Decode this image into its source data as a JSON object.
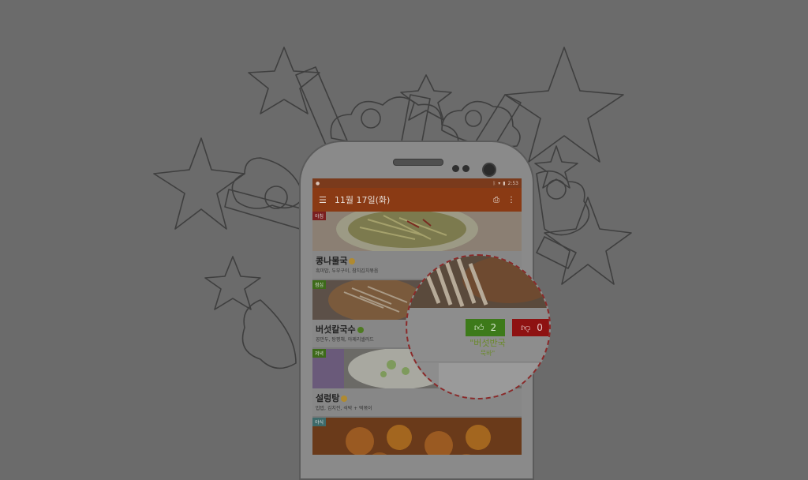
{
  "colors": {
    "backdrop": "#6b6b6b",
    "appbar": "#8a3a14",
    "like": "#3d7a1a",
    "dislike": "#8e1212",
    "menu_highlight": "#6a8a2a"
  },
  "statusbar": {
    "time": "2:53",
    "icons": [
      "bluetooth-icon",
      "wifi-icon",
      "signal-icon",
      "battery-icon"
    ]
  },
  "appbar": {
    "menu_icon": "hamburger-icon",
    "title": "11월 17일(화)",
    "actions": [
      "print-icon",
      "more-vert-icon"
    ]
  },
  "meals": [
    {
      "tag": "아침",
      "name": "콩나물국",
      "badge_color": "#c9a23a",
      "sides": "흑미밥, 두부구이, 참치김치볶음"
    },
    {
      "tag": "점심",
      "name": "버섯칼국수",
      "badge_color": "#5a8a2a",
      "sides": "꽁만두, 탕평채, 아제리샐러드"
    },
    {
      "tag": "저녁",
      "name": "설렁탕",
      "badge_color": "#c9a23a",
      "sides": "밥밥, 김치전, 석박 + 떡볶이"
    },
    {
      "tag": "야식",
      "name": "",
      "badge_color": "#8a8a8a",
      "sides": ""
    }
  ],
  "zoom": {
    "like_count": "2",
    "dislike_count": "0",
    "menu_line1": "\"버섯반국",
    "menu_line2": "묵바\"",
    "like_icon": "thumbs-up-icon",
    "dislike_icon": "thumbs-down-icon"
  }
}
